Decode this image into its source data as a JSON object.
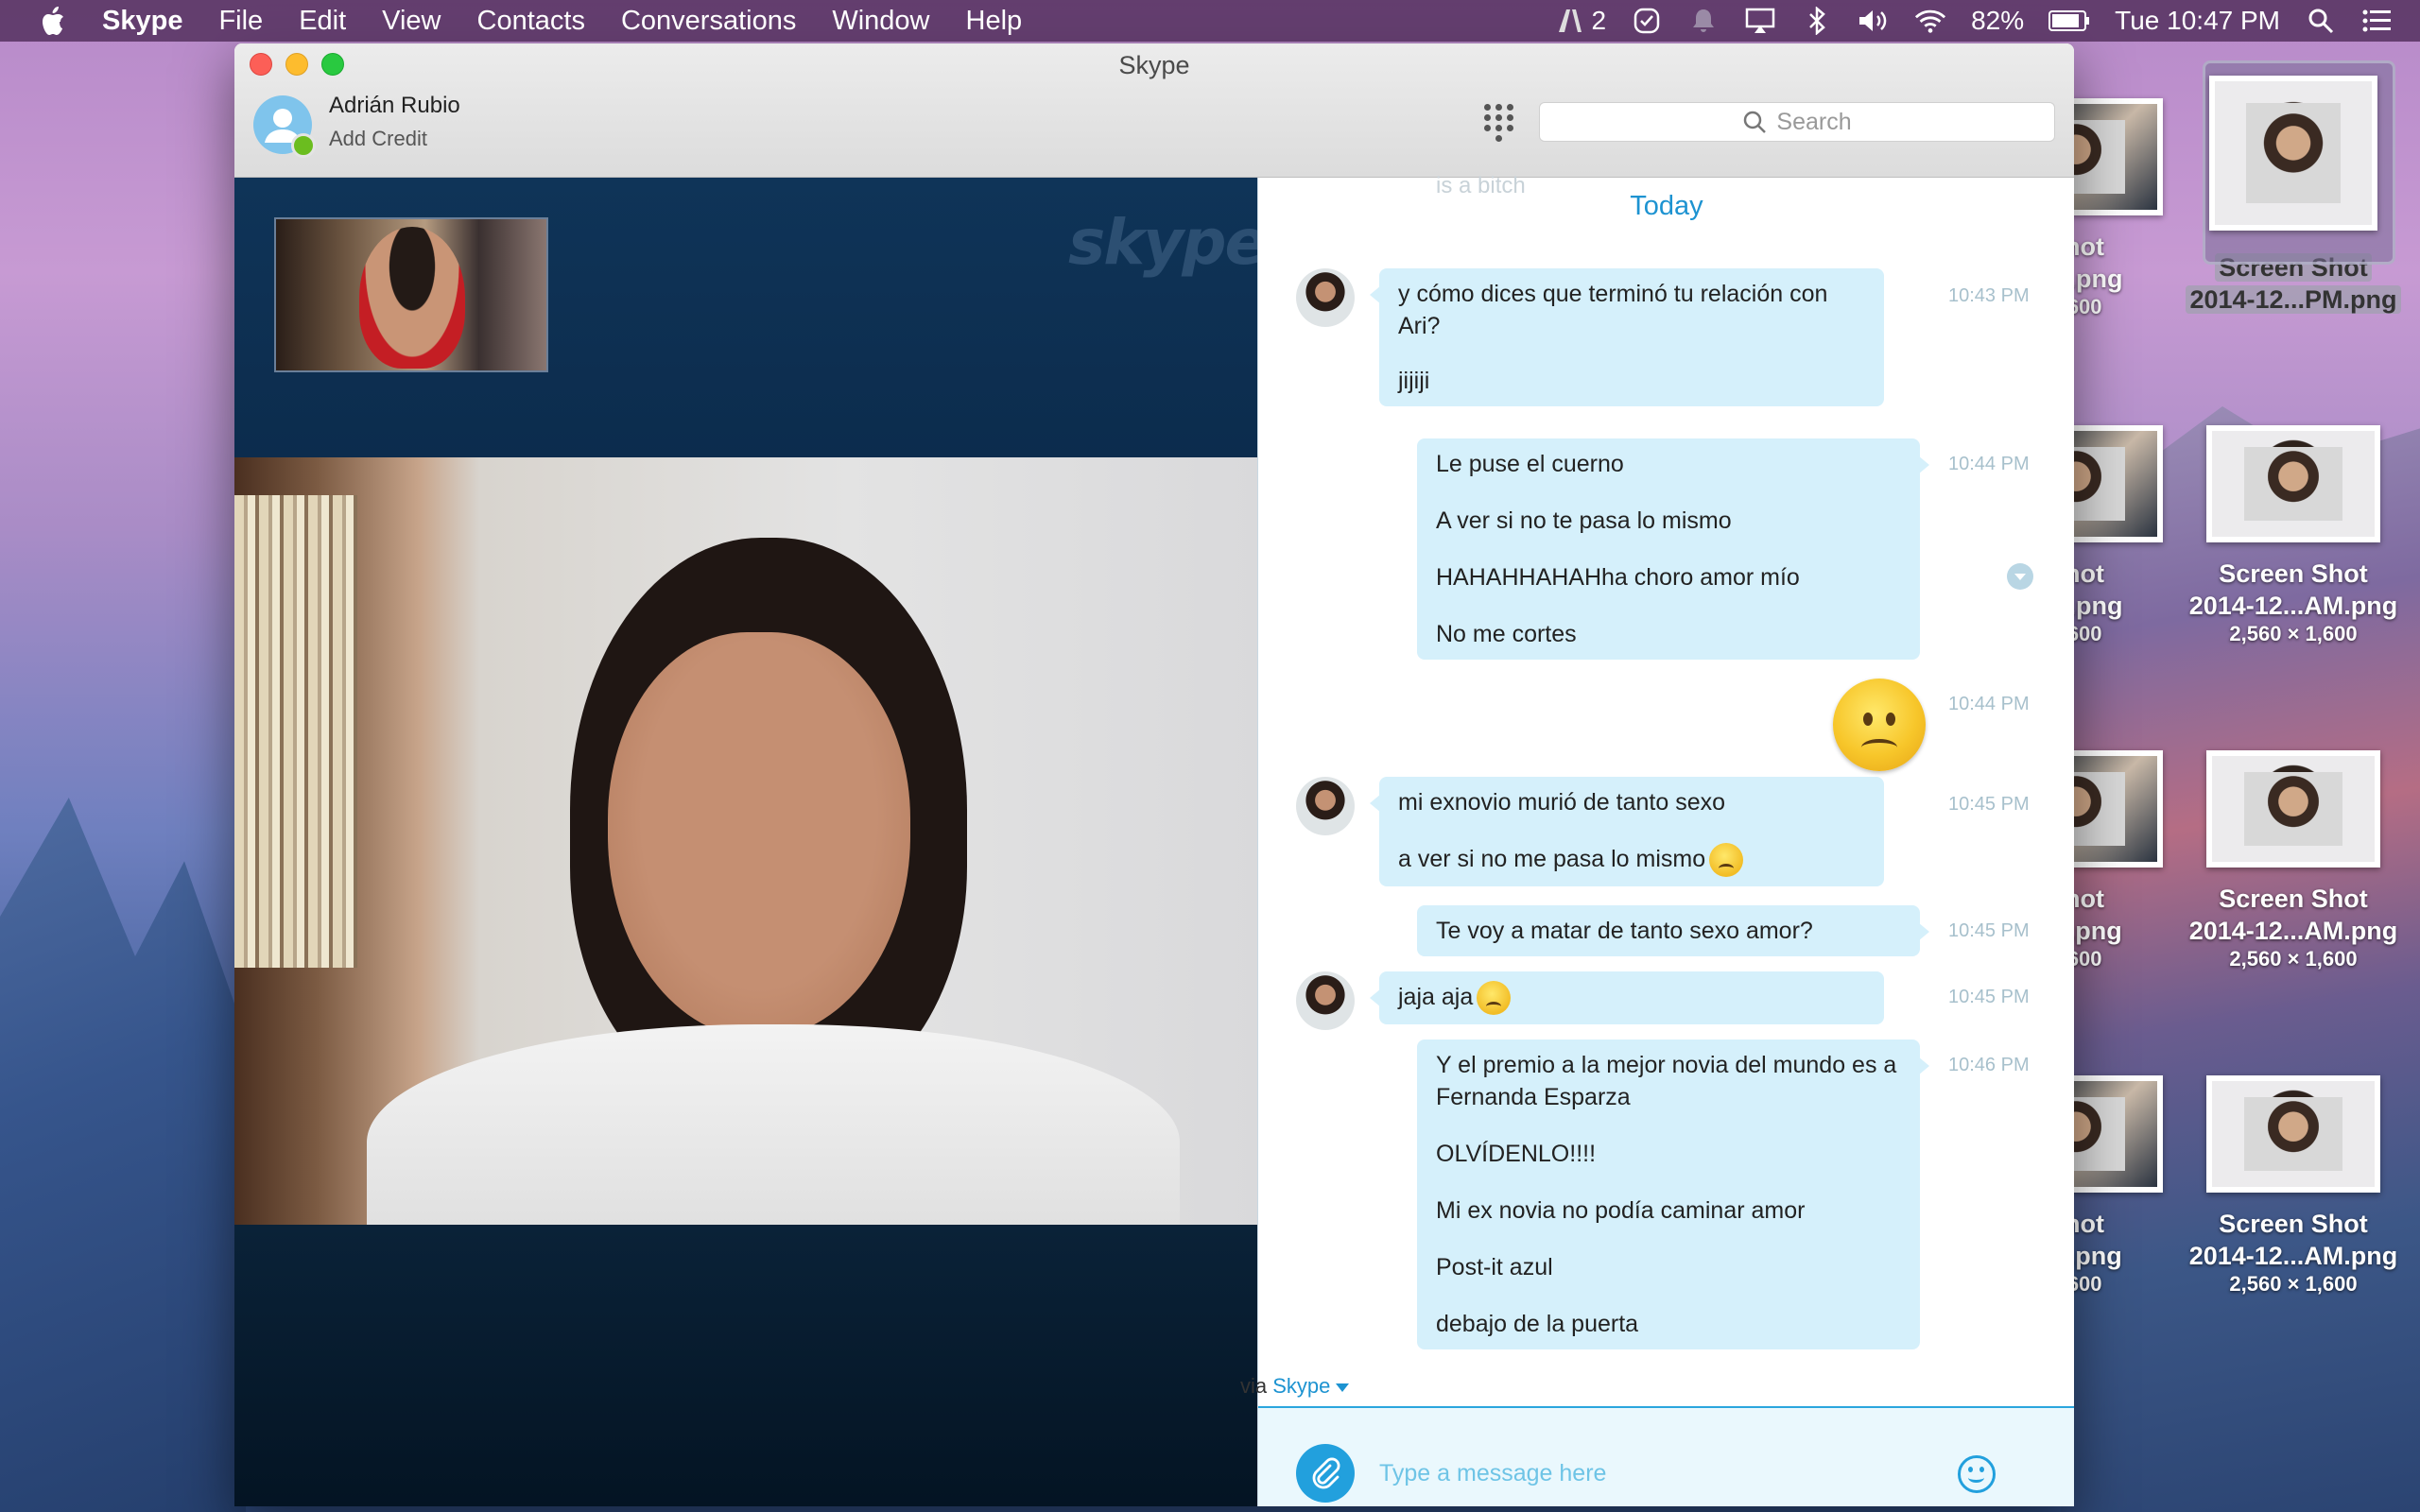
{
  "menubar": {
    "app_name": "Skype",
    "items": [
      "File",
      "Edit",
      "View",
      "Contacts",
      "Conversations",
      "Window",
      "Help"
    ],
    "notification_count": "2",
    "battery": "82%",
    "clock": "Tue 10:47 PM"
  },
  "desktop": {
    "icons": [
      {
        "name_line1": "Shot",
        "name_line2": "AM.png",
        "dims": "1,600"
      },
      {
        "name_line1": "Screen Shot",
        "name_line2": "2014-12...PM.png",
        "dims": ""
      },
      {
        "name_line1": "Shot",
        "name_line2": "AM.png",
        "dims": "1,600"
      },
      {
        "name_line1": "Screen Shot",
        "name_line2": "2014-12...AM.png",
        "dims": "2,560 × 1,600"
      },
      {
        "name_line1": "Shot",
        "name_line2": "PM.png",
        "dims": "1,600"
      },
      {
        "name_line1": "Screen Shot",
        "name_line2": "2014-12...AM.png",
        "dims": "2,560 × 1,600"
      },
      {
        "name_line1": "Shot",
        "name_line2": "PM.png",
        "dims": "1,600"
      },
      {
        "name_line1": "Screen Shot",
        "name_line2": "2014-12...AM.png",
        "dims": "2,560 × 1,600"
      }
    ]
  },
  "window": {
    "title": "Skype",
    "profile": {
      "name": "Adrián Rubio",
      "subtitle": "Add Credit"
    },
    "search_placeholder": "Search"
  },
  "video": {
    "logo_text": "skype"
  },
  "chat": {
    "ghost_text": "is a bitch",
    "date_header": "Today",
    "groups": [
      {
        "direction": "in",
        "time": "10:43 PM",
        "lines": [
          "y cómo dices que terminó tu relación con Ari?",
          "jijiji"
        ]
      },
      {
        "direction": "out",
        "time": "10:44 PM",
        "lines": [
          "Le puse el cuerno",
          "A ver si no te pasa lo mismo",
          "HAHAHHAHAHha choro amor mío",
          "No me cortes"
        ]
      },
      {
        "direction": "out-emoji",
        "time": "10:44 PM",
        "emoji": "worried-face"
      },
      {
        "direction": "in",
        "time": "10:45 PM",
        "lines": [
          "mi exnovio murió de tanto sexo",
          "a ver si no me pasa lo mismo"
        ]
      },
      {
        "direction": "out",
        "time": "10:45 PM",
        "lines": [
          "Te voy a matar de tanto sexo amor?"
        ]
      },
      {
        "direction": "in",
        "time": "10:45 PM",
        "lines": [
          "jaja aja"
        ]
      },
      {
        "direction": "out",
        "time": "10:46 PM",
        "lines": [
          "Y el premio a la mejor novia del mundo es a Fernanda Esparza",
          "OLVÍDENLO!!!!",
          "Mi ex novia no podía caminar amor",
          "Post-it azul",
          "debajo de la puerta"
        ]
      }
    ],
    "via_label": "via",
    "via_link": "Skype",
    "composer_placeholder": "Type a message here"
  },
  "colors": {
    "accent": "#1d93d1",
    "bubble": "#d5f0fb",
    "video_bg": "#0c2b4a"
  }
}
